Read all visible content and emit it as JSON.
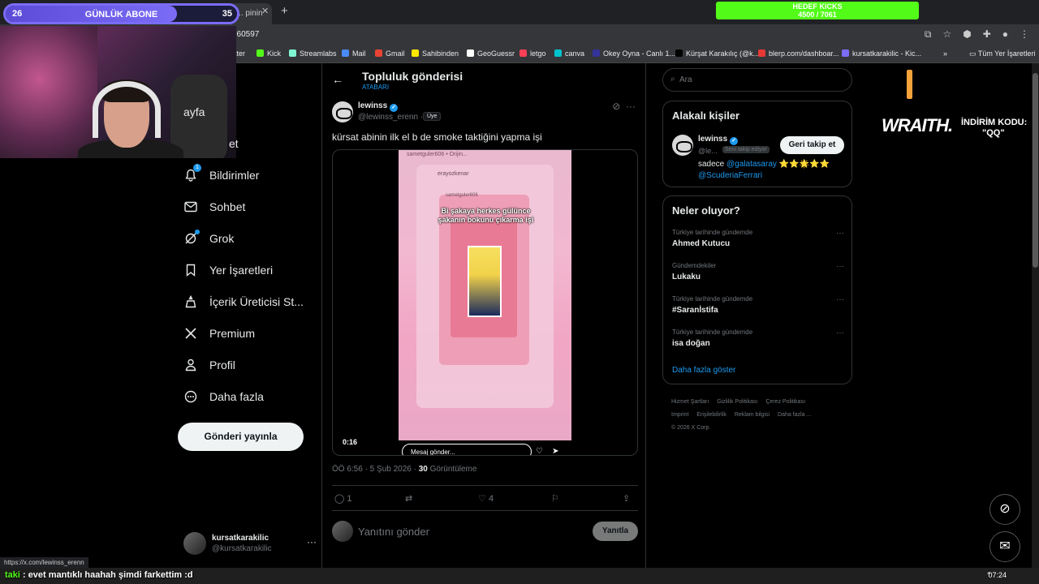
{
  "browser": {
    "tab_label": "'te lewinss: \"kür... pinin",
    "url_text": "760597",
    "bookmarks": [
      {
        "label": "itter",
        "color": "#1d9bf0"
      },
      {
        "label": "Kick",
        "color": "#53fc18"
      },
      {
        "label": "Streamlabs",
        "color": "#80f5d2"
      },
      {
        "label": "Mail",
        "color": "#4a8af4"
      },
      {
        "label": "Gmail",
        "color": "#ea4335"
      },
      {
        "label": "Sahibinden",
        "color": "#ffe800"
      },
      {
        "label": "GeoGuessr",
        "color": "#ffffff"
      },
      {
        "label": "letgo",
        "color": "#ff3f55"
      },
      {
        "label": "canva",
        "color": "#00c4cc"
      },
      {
        "label": "Okey Oyna - Canlı 1...",
        "color": "#333399"
      },
      {
        "label": "Kürşat Karakılıç (@k...",
        "color": "#000000"
      },
      {
        "label": "blerp.com/dashboar...",
        "color": "#e53935"
      },
      {
        "label": "kursatkarakilic - Kic...",
        "color": "#7b6cf6"
      }
    ],
    "bookmarks_more": "»",
    "all_bookmarks": "Tüm Yer İşaretleri",
    "hover_url": "https://x.com/lewinss_erenn"
  },
  "overlay": {
    "sub_goal_left": "26",
    "sub_goal_label": "GÜNLÜK ABONE",
    "sub_goal_right": "35",
    "sub_goal_progress": 0.74,
    "kicks_label": "HEDEF KICKS",
    "kicks_value": "4500 / 7061",
    "sponsor_brand": "WRAITH.",
    "sponsor_code_label": "İNDİRİM KODU:",
    "sponsor_code": "\"QQ\"",
    "chat_user": "taki",
    "chat_message": ": evet mantıklı haahah şimdi farkettim :d"
  },
  "nav": {
    "items": [
      {
        "label": "ayfa",
        "icon": "home-icon"
      },
      {
        "label": "et",
        "icon": "explore-icon"
      },
      {
        "label": "Bildirimler",
        "icon": "bell-icon",
        "badge": "1"
      },
      {
        "label": "Sohbet",
        "icon": "mail-icon"
      },
      {
        "label": "Grok",
        "icon": "grok-icon"
      },
      {
        "label": "Yer İşaretleri",
        "icon": "bookmark-icon"
      },
      {
        "label": "İçerik Üreticisi St...",
        "icon": "creator-icon"
      },
      {
        "label": "Premium",
        "icon": "x-logo-icon"
      },
      {
        "label": "Profil",
        "icon": "person-icon"
      },
      {
        "label": "Daha fazla",
        "icon": "more-circle-icon"
      }
    ],
    "post_button": "Gönderi yayınla",
    "account_name": "kursatkarakilic",
    "account_handle": "@kursatkarakilic",
    "account_more": "···"
  },
  "post": {
    "header_title": "Topluluk gönderisi",
    "header_sub": "ATABARI",
    "author_name": "lewinss",
    "author_handle": "@lewinss_erenn ·",
    "author_role": "Üye",
    "text": "kürsat abinin ilk el b de smoke taktiğini yapma işi",
    "video": {
      "top_user": "sametguler606 • Orijin...",
      "user2": "erayozkenar",
      "user3": "sametguler606",
      "caption": "Bi şakaya herkes gülünce şakanın bokunu çıkarma işi",
      "time": "0:16",
      "message_placeholder": "Mesaj gönder..."
    },
    "meta_time": "ÖÖ 6:56 · 5 Şub 2026 · ",
    "views": "30",
    "views_label": " Görüntüleme",
    "replies": "1",
    "likes": "4",
    "reply_placeholder": "Yanıtını gönder",
    "reply_button": "Yanıtla"
  },
  "sidebar": {
    "search_placeholder": "Ara",
    "related_title": "Alakalı kişiler",
    "related_name": "lewinss",
    "related_handle": "@le...",
    "related_tag": "Seni takip ediyor",
    "follow_back": "Geri takip et",
    "bio_prefix": "sadece ",
    "bio_link1": "@galatasaray",
    "bio_stars": " ⭐⭐🌟⭐⭐",
    "bio_link2": "@ScuderiaFerrari",
    "trends_title": "Neler oluyor?",
    "trends": [
      {
        "context": "Türkiye tarihinde gündemde",
        "title": "Ahmed Kutucu"
      },
      {
        "context": "Gündemdekiler",
        "title": "Lukaku"
      },
      {
        "context": "Türkiye tarihinde gündemde",
        "title": "#Saranİstifa"
      },
      {
        "context": "Türkiye tarihinde gündemde",
        "title": "isa doğan"
      }
    ],
    "show_more": "Daha fazla göster",
    "footer_links": [
      "Hizmet Şartları",
      "Gizlilik Politikası",
      "Çerez Politikası",
      "Imprint",
      "Erişilebilirlik",
      "Reklam bilgisi",
      "Daha fazla ..."
    ],
    "copyright": "© 2026 X Corp."
  },
  "system": {
    "clock": "07:24"
  }
}
